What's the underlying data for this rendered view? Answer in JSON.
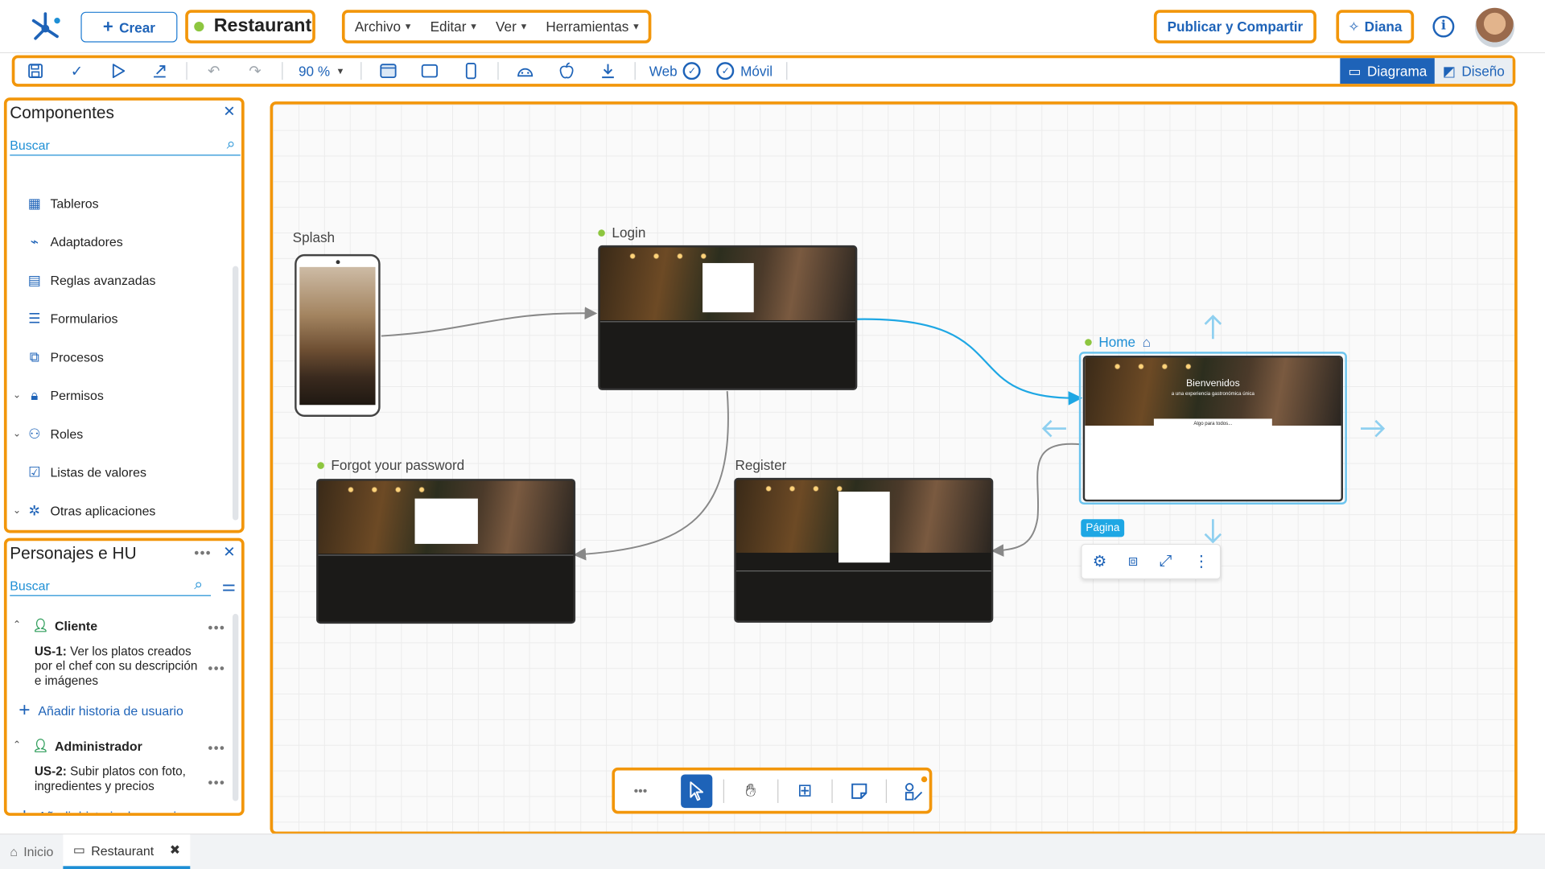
{
  "app": {
    "create_label": "Crear",
    "project_name": "Restaurant",
    "menus": [
      "Archivo",
      "Editar",
      "Ver",
      "Herramientas"
    ],
    "publish_label": "Publicar y Compartir",
    "assistant_label": "Diana",
    "info_label": "i"
  },
  "toolbar": {
    "zoom": "90 %",
    "web_label": "Web",
    "mobile_label": "Móvil",
    "view_diagram": "Diagrama",
    "view_design": "Diseño"
  },
  "components": {
    "title": "Componentes",
    "search_placeholder": "Buscar",
    "items": [
      "Tableros",
      "Adaptadores",
      "Reglas avanzadas",
      "Formularios",
      "Procesos",
      "Permisos",
      "Roles",
      "Listas de valores",
      "Otras aplicaciones"
    ]
  },
  "personas": {
    "title": "Personajes e HU",
    "search_placeholder": "Buscar",
    "groups": [
      {
        "name": "Cliente",
        "story_id": "US-1:",
        "story_text": "Ver los platos creados por el chef con su descripción e imágenes",
        "add_label": "Añadir historia de usuario"
      },
      {
        "name": "Administrador",
        "story_id": "US-2:",
        "story_text": "Subir platos con foto, ingredientes y precios",
        "add_label": "Añadir historia de usuario"
      }
    ]
  },
  "canvas": {
    "screens": {
      "splash": "Splash",
      "login": "Login",
      "home": "Home",
      "forgot": "Forgot your password",
      "register": "Register"
    },
    "home_hero_title": "Bienvenidos",
    "home_hero_sub": "a una experiencia gastronómica única",
    "home_card_title": "Algo para todos...",
    "page_badge": "Página"
  },
  "tabs": [
    "Inicio",
    "Restaurant"
  ],
  "colors": {
    "accent": "#1e63b8",
    "highlight": "#f2960a",
    "status_green": "#8dc63f",
    "link": "#1e8fd5"
  }
}
